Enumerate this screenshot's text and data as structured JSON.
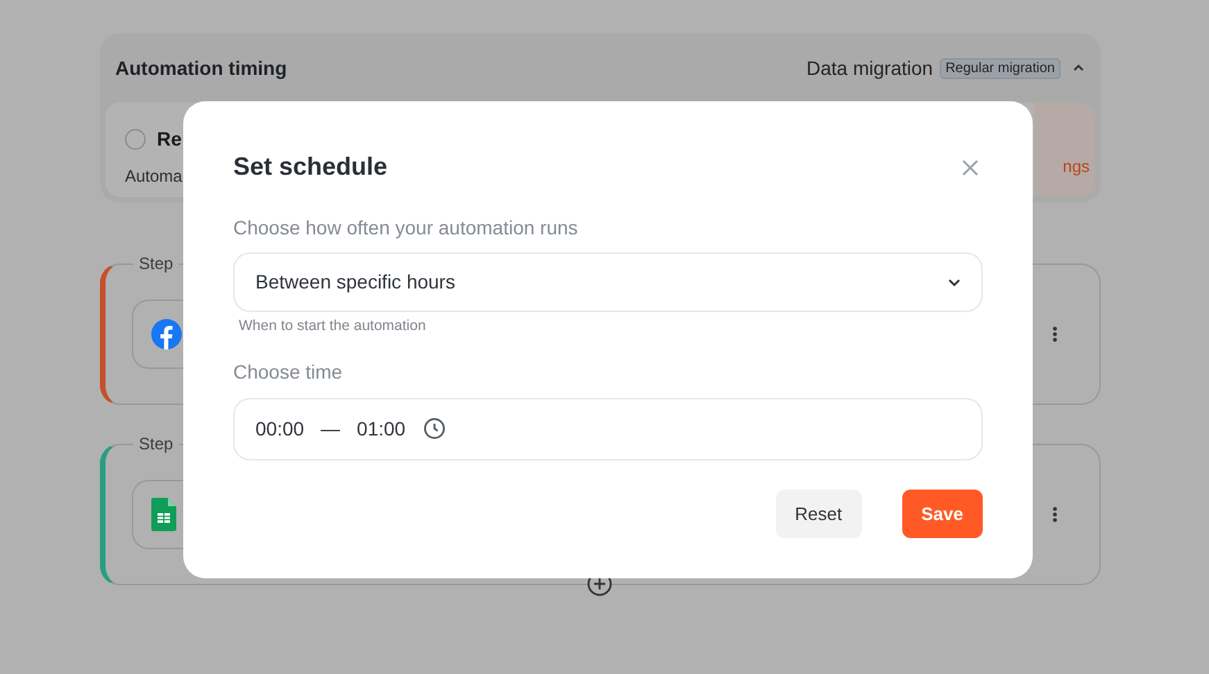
{
  "automation_timing": {
    "title": "Automation timing",
    "type_label": "Data migration",
    "type_badge": "Regular migration",
    "expanded": true,
    "option": {
      "label": "Re",
      "description": "Automa",
      "link": "ngs",
      "selected": false
    }
  },
  "steps": [
    {
      "label": "Step",
      "color": "#c5502a",
      "kind": "facebook"
    },
    {
      "label": "Step",
      "color": "#2a9d80",
      "kind": "sheets"
    }
  ],
  "modal": {
    "title": "Set schedule",
    "frequency": {
      "label": "Choose how often your automation runs",
      "value": "Between specific hours",
      "hint": "When to start the automation"
    },
    "time": {
      "label": "Choose time",
      "start": "00:00",
      "separator": "—",
      "end": "01:00"
    },
    "buttons": [
      {
        "label": "Reset",
        "kind": "secondary"
      },
      {
        "label": "Save",
        "kind": "primary"
      }
    ]
  }
}
